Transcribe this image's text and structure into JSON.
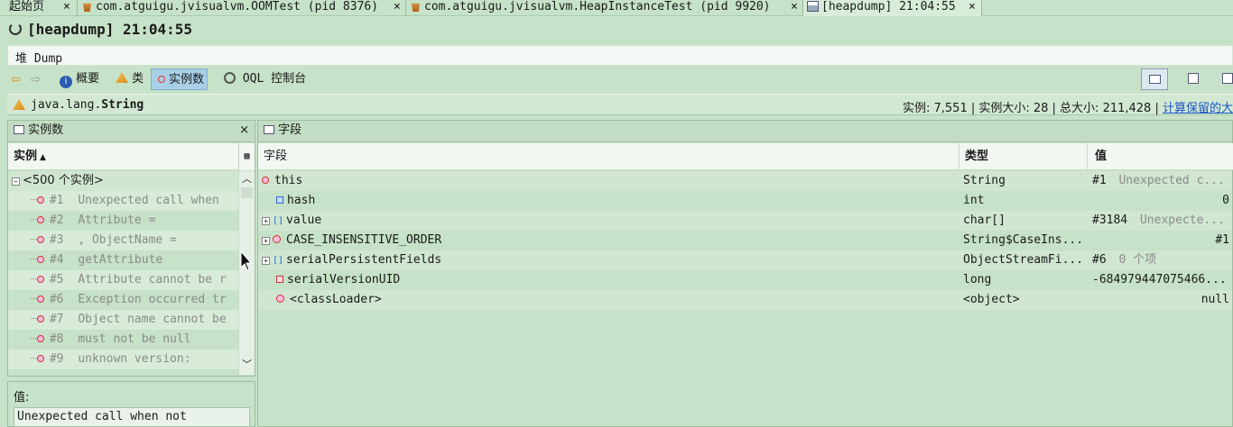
{
  "tabs": [
    {
      "label": "起始页",
      "icon": "none"
    },
    {
      "label": "com.atguigu.jvisualvm.OOMTest (pid 8376)",
      "icon": "java-cup-icon"
    },
    {
      "label": "com.atguigu.jvisualvm.HeapInstanceTest (pid 9920)",
      "icon": "java-cup-icon"
    },
    {
      "label": "[heapdump] 21:04:55",
      "icon": "heapdump-icon"
    }
  ],
  "tab_close": "×",
  "title": "[heapdump] 21:04:55",
  "section_label": "堆 Dump",
  "toolbar": {
    "summary": "概要",
    "classes": "类",
    "instances": "实例数",
    "oql": "OQL 控制台"
  },
  "class_strip": {
    "class_prefix": "java.lang.",
    "class_name": "String",
    "stats": "实例: 7,551 | 实例大小: 28 | 总大小: 211,428 |",
    "retained_link": "计算保留的大"
  },
  "instances_panel": {
    "title": "实例数",
    "column": "实例",
    "group": "<500 个实例>",
    "rows": [
      {
        "id": "#1",
        "value": "Unexpected call when"
      },
      {
        "id": "#2",
        "value": "Attribute ="
      },
      {
        "id": "#3",
        "value": ", ObjectName ="
      },
      {
        "id": "#4",
        "value": "getAttribute"
      },
      {
        "id": "#5",
        "value": "Attribute cannot be r"
      },
      {
        "id": "#6",
        "value": "Exception occurred tr"
      },
      {
        "id": "#7",
        "value": "Object name cannot be"
      },
      {
        "id": "#8",
        "value": " must not be null"
      },
      {
        "id": "#9",
        "value": "unknown version:"
      }
    ]
  },
  "value_panel": {
    "label": "值:",
    "text": "Unexpected call when not"
  },
  "fields_panel": {
    "title": "字段",
    "columns": {
      "field": "字段",
      "type": "类型",
      "value": "值"
    },
    "rows": [
      {
        "name": "this",
        "type": "String",
        "value": "#1",
        "value_extra": "Unexpected c..."
      },
      {
        "name": "hash",
        "type": "int",
        "value": "0",
        "value_extra": ""
      },
      {
        "name": "value",
        "type": "char[]",
        "value": "#3184",
        "value_extra": "Unexpecte..."
      },
      {
        "name": "CASE_INSENSITIVE_ORDER",
        "type": "String$CaseIns...",
        "value": "#1",
        "value_extra": ""
      },
      {
        "name": "serialPersistentFields",
        "type": "ObjectStreamFi...",
        "value": "#6",
        "value_extra": "0 个项"
      },
      {
        "name": "serialVersionUID",
        "type": "long",
        "value": "-684979447075466...",
        "value_extra": ""
      },
      {
        "name": "<classLoader>",
        "type": "<object>",
        "value": "null",
        "value_extra": ""
      }
    ]
  },
  "colors": {
    "background": "#c6e2c8",
    "selection": "#a9cfe6",
    "link": "#1a55c8"
  }
}
